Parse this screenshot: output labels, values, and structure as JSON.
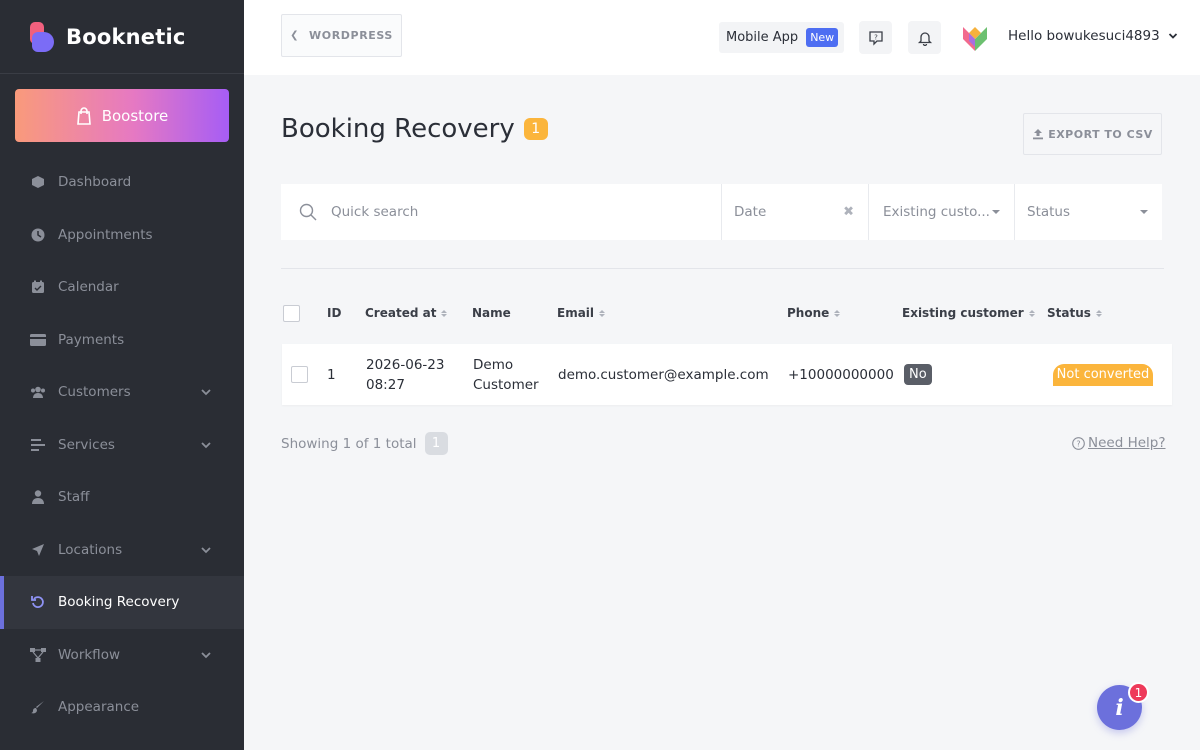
{
  "brand": {
    "name": "Booknetic"
  },
  "sidebar": {
    "boostore_label": "Boostore",
    "items": [
      {
        "label": "Dashboard",
        "icon": "dashboard-icon"
      },
      {
        "label": "Appointments",
        "icon": "clock-icon"
      },
      {
        "label": "Calendar",
        "icon": "calendar-icon"
      },
      {
        "label": "Payments",
        "icon": "credit-card-icon"
      },
      {
        "label": "Customers",
        "icon": "users-icon",
        "expandable": true
      },
      {
        "label": "Services",
        "icon": "list-icon",
        "expandable": true
      },
      {
        "label": "Staff",
        "icon": "user-icon"
      },
      {
        "label": "Locations",
        "icon": "location-arrow-icon",
        "expandable": true
      },
      {
        "label": "Booking Recovery",
        "icon": "undo-icon",
        "active": true
      },
      {
        "label": "Workflow",
        "icon": "workflow-icon",
        "expandable": true
      },
      {
        "label": "Appearance",
        "icon": "brush-icon"
      }
    ]
  },
  "header": {
    "wordpress_label": "WORDPRESS",
    "mobile_app_label": "Mobile App",
    "new_badge": "New",
    "greeting": "Hello bowukesuci4893"
  },
  "page": {
    "title": "Booking Recovery",
    "count": "1",
    "export_label": "EXPORT TO CSV"
  },
  "filters": {
    "search_placeholder": "Quick search",
    "date_placeholder": "Date",
    "existing_placeholder": "Existing custo...",
    "status_placeholder": "Status"
  },
  "table": {
    "columns": [
      "ID",
      "Created at",
      "Name",
      "Email",
      "Phone",
      "Existing customer",
      "Status"
    ],
    "rows": [
      {
        "id": "1",
        "created_date": "2026-06-23",
        "created_time": "08:27",
        "name_first": "Demo",
        "name_last": "Customer",
        "email": "demo.customer@example.com",
        "phone": "+10000000000",
        "existing": "No",
        "status": "Not converted"
      }
    ]
  },
  "footer": {
    "showing": "Showing 1 of 1 total",
    "page": "1",
    "help": "Need Help?"
  },
  "fab": {
    "label": "i",
    "badge": "1"
  },
  "colors": {
    "sidebar_bg": "#2a2d34",
    "accent": "#6c70dc",
    "warning": "#fbb53c",
    "new_badge": "#4e6ef2",
    "fab_badge": "#ee3a5a"
  }
}
